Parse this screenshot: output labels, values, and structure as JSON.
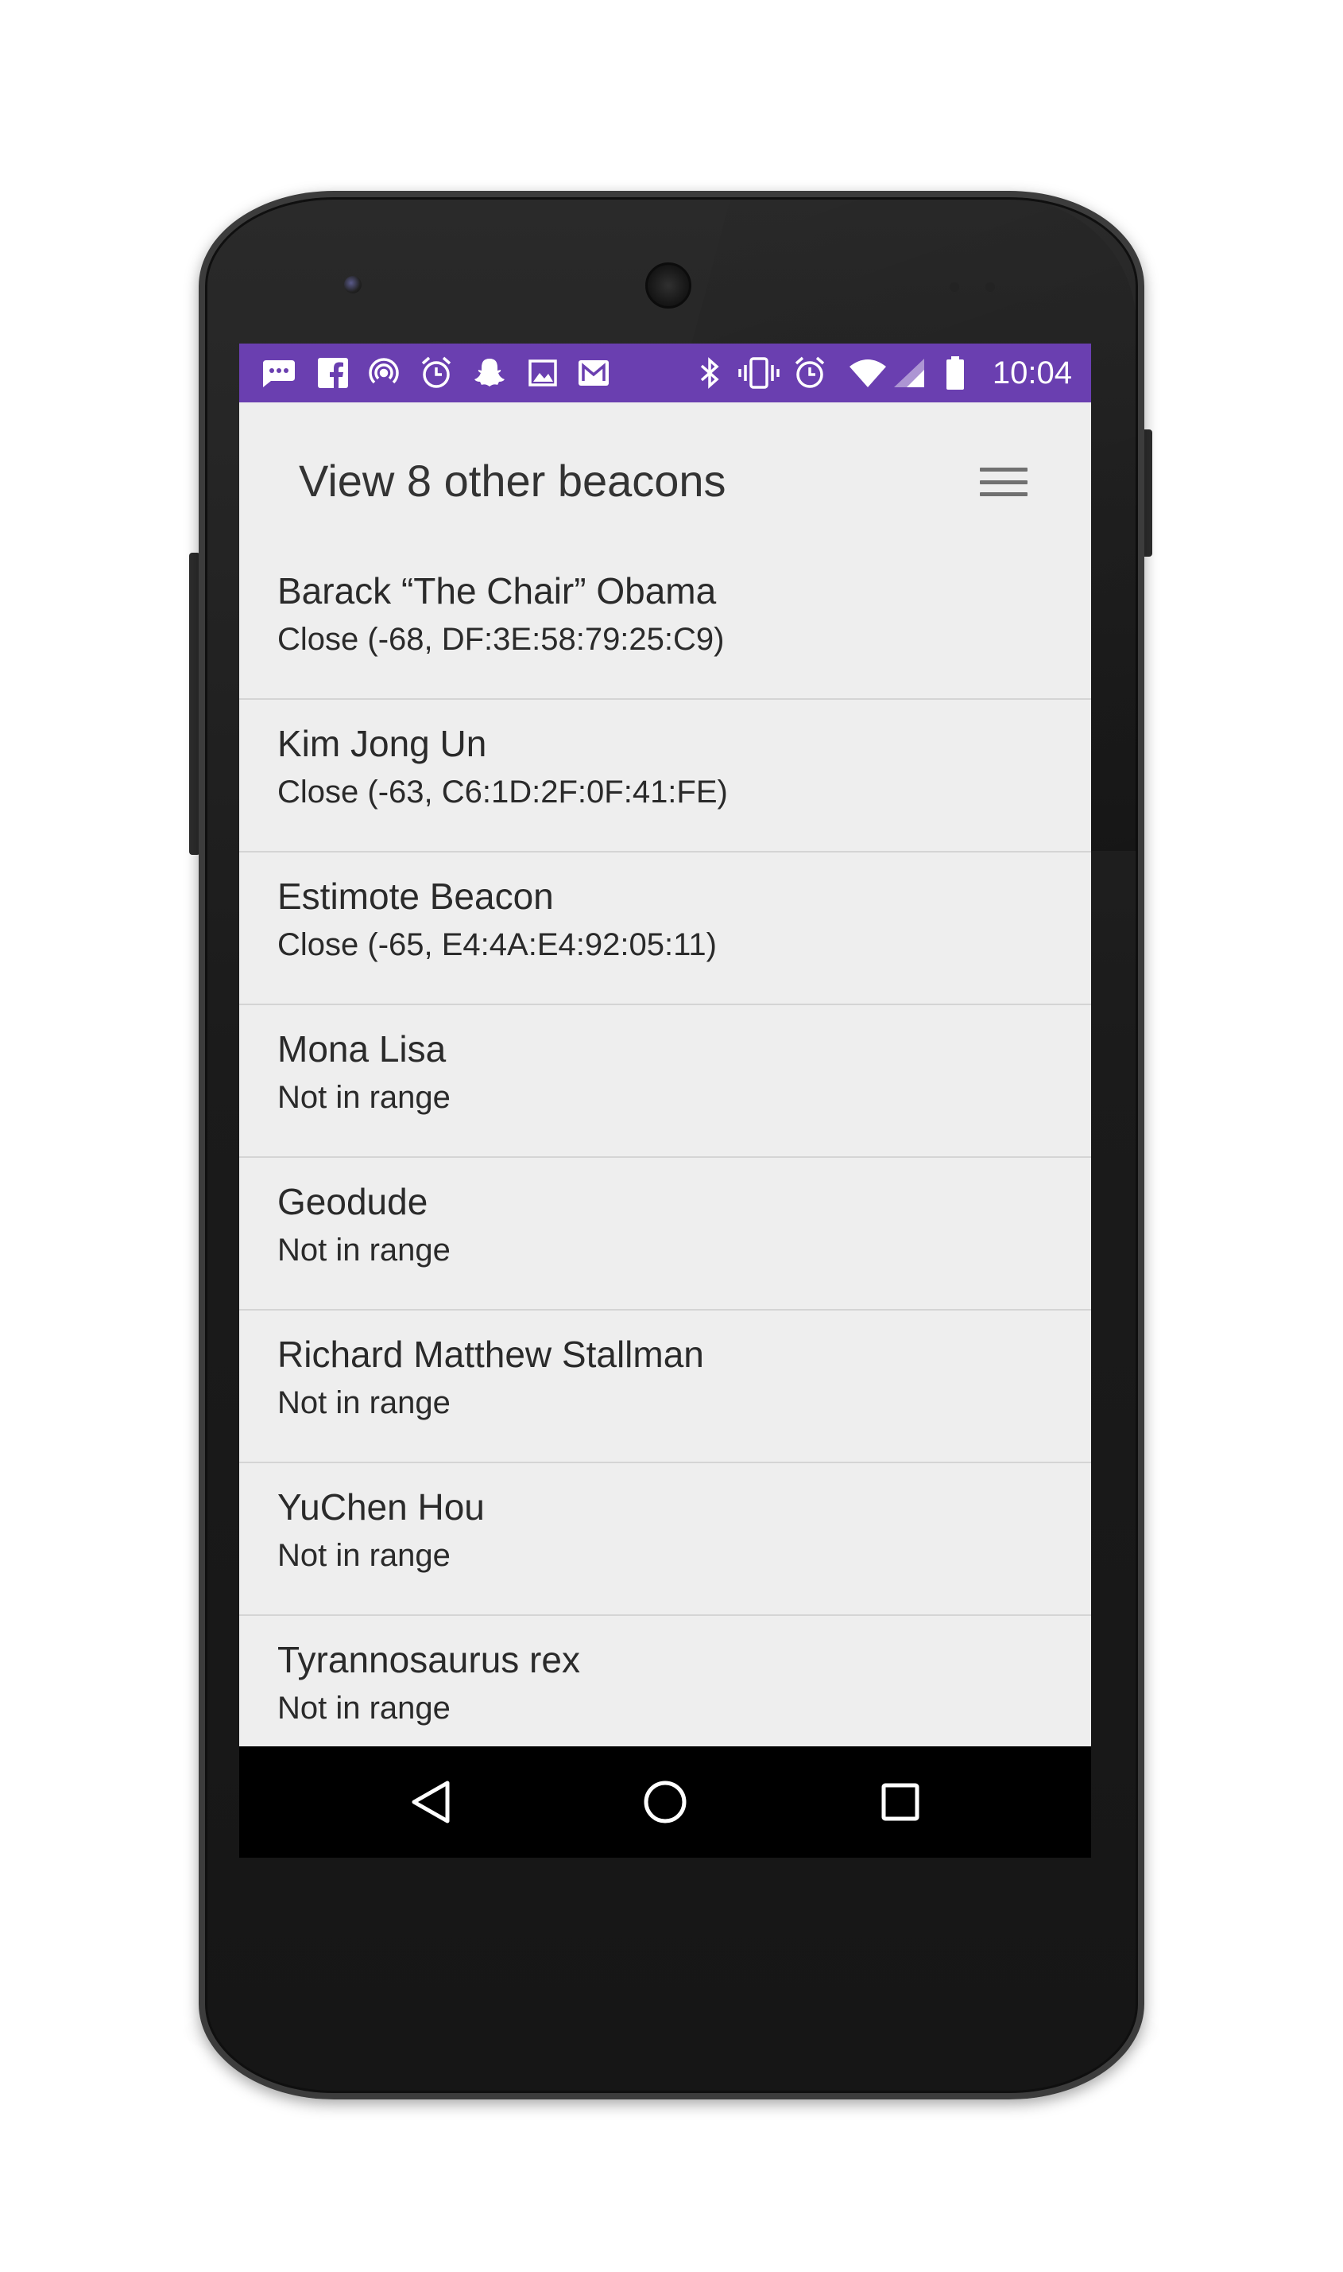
{
  "status_bar": {
    "time": "10:04",
    "color": "#6a3fb0",
    "left_icons": [
      "chat-bubble-icon",
      "facebook-icon",
      "hotspot-icon",
      "alarm-clock-icon",
      "snapchat-icon",
      "image-icon",
      "inbox-icon"
    ],
    "right_icons": [
      "bluetooth-icon",
      "vibrate-icon",
      "alarm-icon",
      "wifi-icon",
      "cell-signal-icon",
      "battery-icon"
    ]
  },
  "header": {
    "title": "View 8 other beacons",
    "menu_icon": "hamburger-menu-icon"
  },
  "beacons": [
    {
      "name": "Barack “The Chair” Obama",
      "status": "Close (-68, DF:3E:58:79:25:C9)"
    },
    {
      "name": "Kim Jong Un",
      "status": "Close (-63, C6:1D:2F:0F:41:FE)"
    },
    {
      "name": "Estimote Beacon",
      "status": "Close (-65, E4:4A:E4:92:05:11)"
    },
    {
      "name": "Mona Lisa",
      "status": "Not in range"
    },
    {
      "name": "Geodude",
      "status": "Not in range"
    },
    {
      "name": "Richard Matthew Stallman",
      "status": "Not in range"
    },
    {
      "name": "YuChen Hou",
      "status": "Not in range"
    },
    {
      "name": "Tyrannosaurus rex",
      "status": "Not in range"
    }
  ],
  "nav_bar": {
    "back": "back-triangle-icon",
    "home": "home-circle-icon",
    "recents": "recents-square-icon"
  }
}
